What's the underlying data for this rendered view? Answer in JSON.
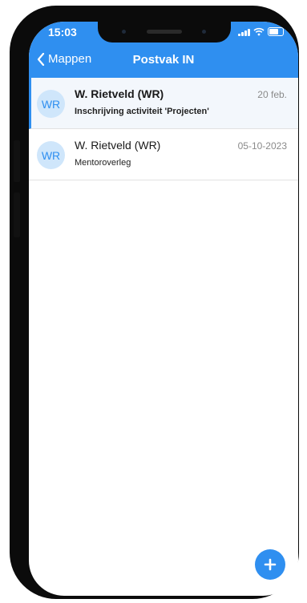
{
  "status_bar": {
    "time": "15:03"
  },
  "nav": {
    "back_label": "Mappen",
    "title": "Postvak IN"
  },
  "messages": [
    {
      "avatar": "WR",
      "sender": "W. Rietveld (WR)",
      "subject": "Inschrijving activiteit 'Projecten'",
      "date": "20 feb.",
      "unread": true
    },
    {
      "avatar": "WR",
      "sender": "W. Rietveld (WR)",
      "subject": "Mentoroverleg",
      "date": "05-10-2023",
      "unread": false
    }
  ],
  "fab": {
    "icon": "plus-icon"
  },
  "colors": {
    "accent": "#2f8ff0",
    "avatar_bg": "#cfe6fb"
  }
}
